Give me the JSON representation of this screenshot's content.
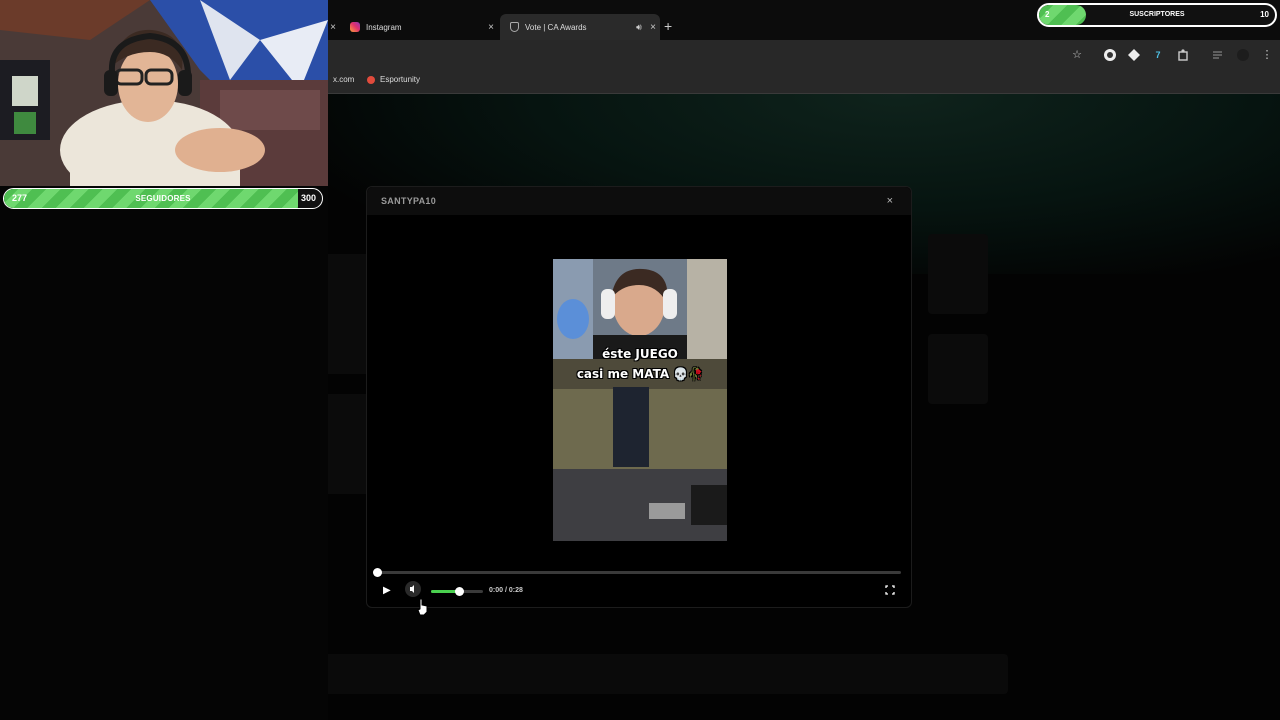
{
  "browser": {
    "tabs": [
      {
        "label": "Instagram",
        "close": "×"
      },
      {
        "label": "Vote | CA Awards",
        "close": "×",
        "active": true
      }
    ],
    "stray_close": "×",
    "new_tab": "+",
    "bookmarks": [
      {
        "label": "x.com"
      },
      {
        "label": "Esportunity"
      }
    ]
  },
  "overlay": {
    "followers": {
      "current": "277",
      "label": "SEGUIDORES",
      "goal": "300",
      "progress": 0.923
    },
    "subscribers": {
      "current": "2",
      "label": "SUSCRIPTORES",
      "goal": "10",
      "progress": 0.2
    }
  },
  "modal": {
    "title": "SANTYPA10",
    "close": "×",
    "video_caption_line1": "éste JUEGO",
    "video_caption_line2": "casi me MATA 💀🥀",
    "time": "0:00 / 0:28",
    "playback_progress": 0.0,
    "volume": 0.55
  },
  "colors": {
    "accent_green": "#4ad04f",
    "page_bg": "#030303"
  }
}
